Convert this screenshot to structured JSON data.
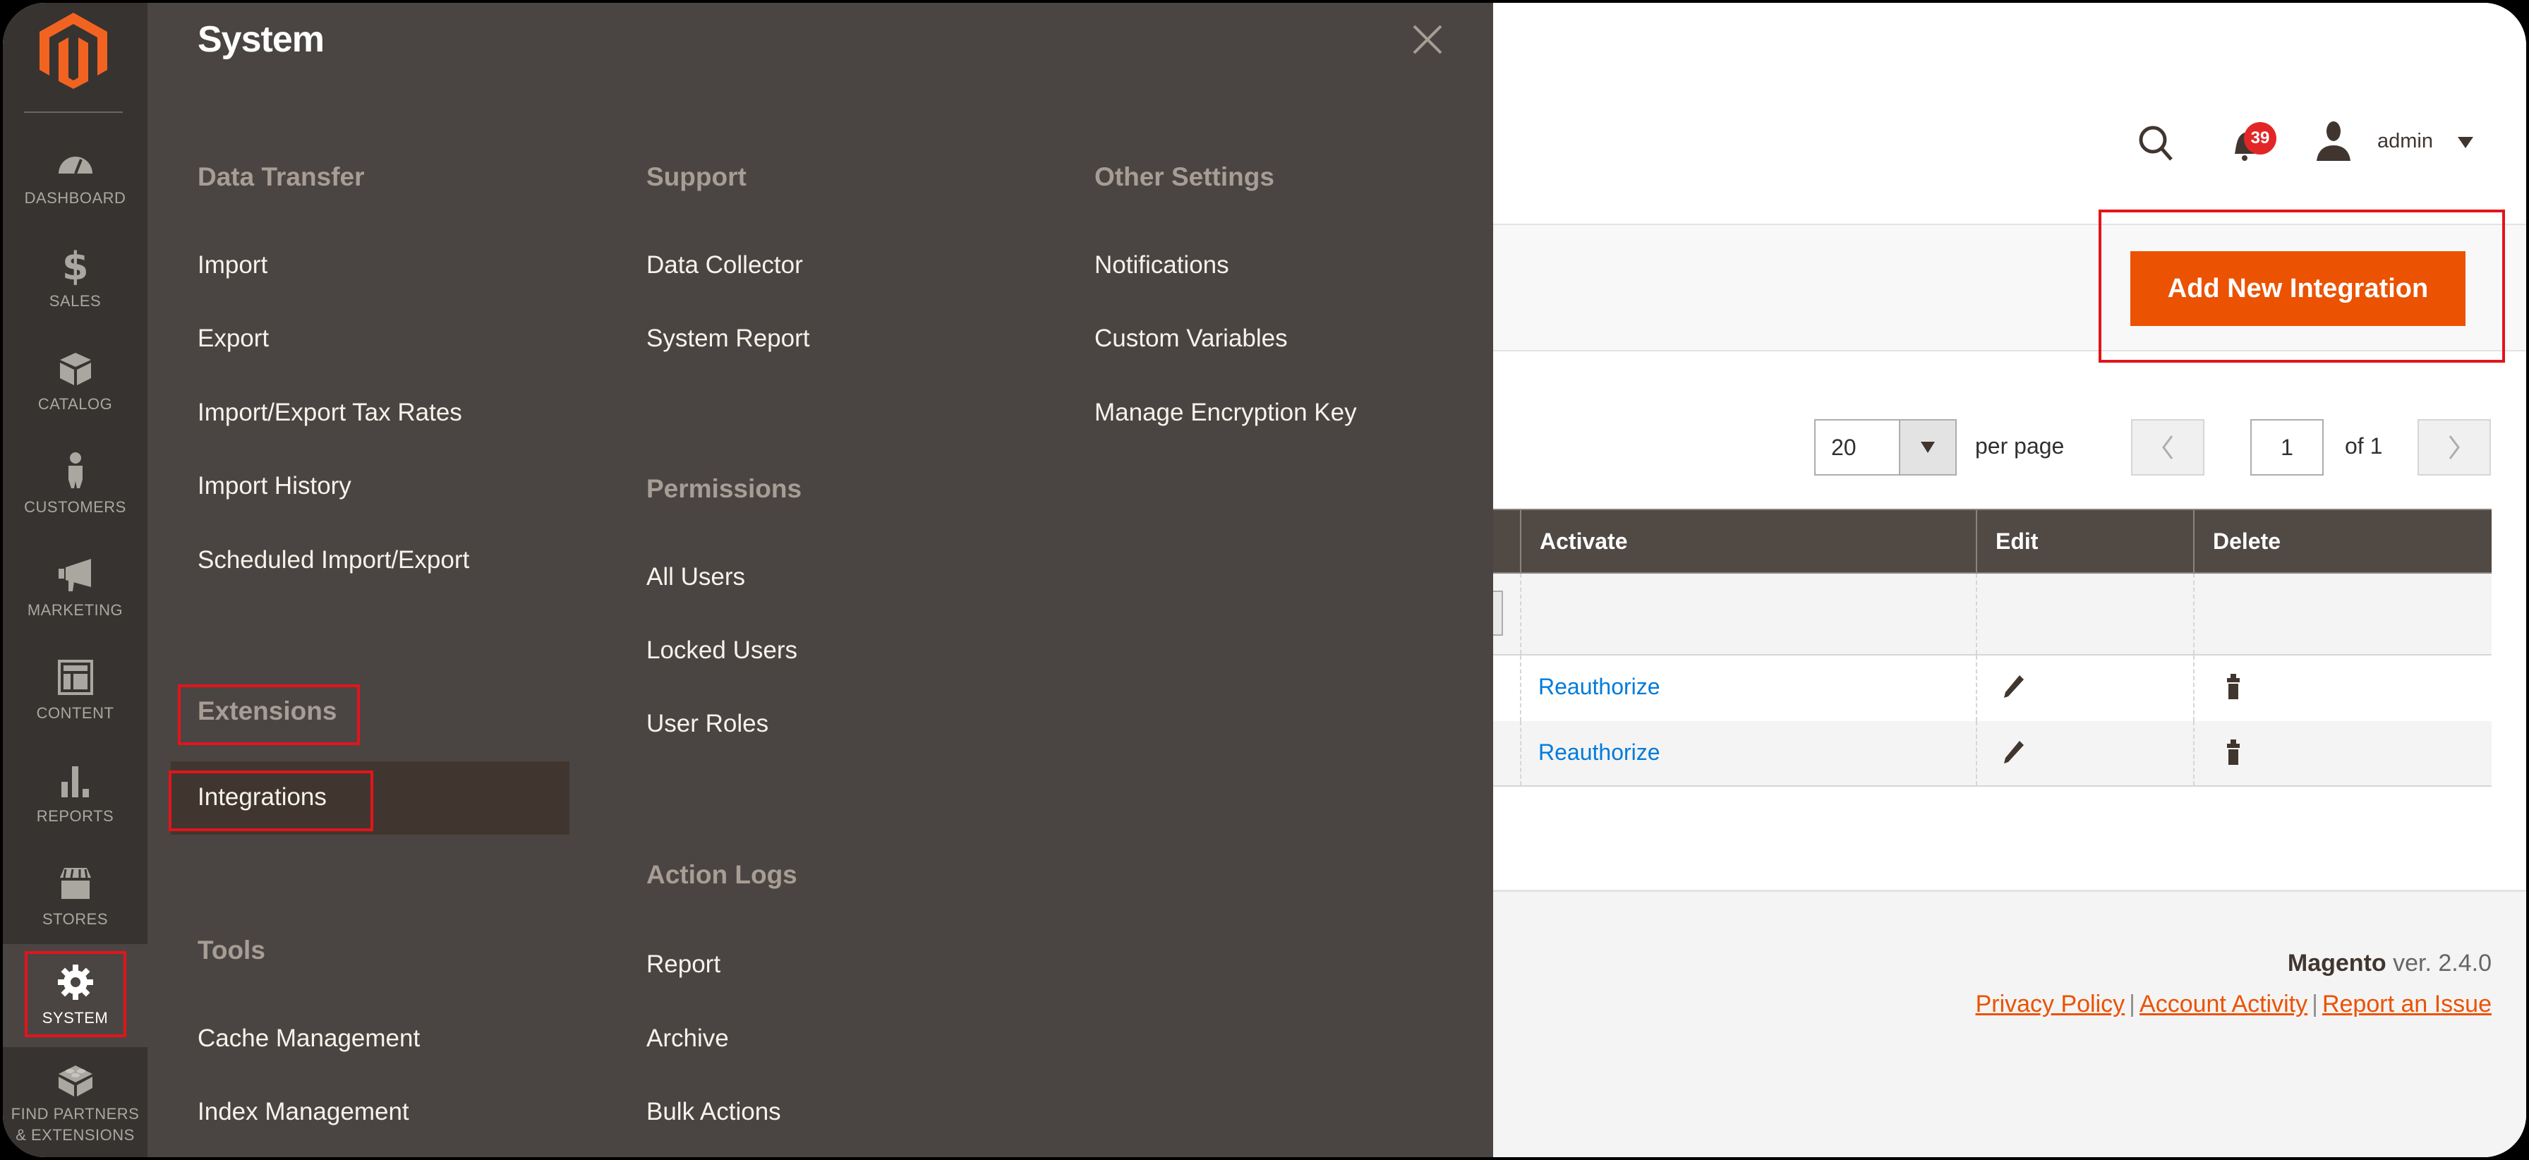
{
  "nav": {
    "logo": "magento-logo",
    "items": [
      {
        "label": "DASHBOARD",
        "icon": "dashboard-gauge-icon"
      },
      {
        "label": "SALES",
        "icon": "dollar-icon"
      },
      {
        "label": "CATALOG",
        "icon": "box-icon"
      },
      {
        "label": "CUSTOMERS",
        "icon": "person-icon"
      },
      {
        "label": "MARKETING",
        "icon": "megaphone-icon"
      },
      {
        "label": "CONTENT",
        "icon": "layout-icon"
      },
      {
        "label": "REPORTS",
        "icon": "bar-chart-icon"
      },
      {
        "label": "STORES",
        "icon": "storefront-icon"
      },
      {
        "label": "SYSTEM",
        "icon": "gear-icon",
        "active": true
      },
      {
        "label": "FIND PARTNERS & EXTENSIONS",
        "icon": "lego-brick-icon"
      }
    ]
  },
  "flyout": {
    "title": "System",
    "close_icon": "close-icon",
    "columns": [
      {
        "groups": [
          {
            "heading": "Data Transfer",
            "items": [
              "Import",
              "Export",
              "Import/Export Tax Rates",
              "Import History",
              "Scheduled Import/Export"
            ]
          },
          {
            "heading": "Extensions",
            "items": [
              "Integrations"
            ]
          },
          {
            "heading": "Tools",
            "items": [
              "Cache Management",
              "Index Management"
            ]
          }
        ]
      },
      {
        "groups": [
          {
            "heading": "Support",
            "items": [
              "Data Collector",
              "System Report"
            ]
          },
          {
            "heading": "Permissions",
            "items": [
              "All Users",
              "Locked Users",
              "User Roles"
            ]
          },
          {
            "heading": "Action Logs",
            "items": [
              "Report",
              "Archive",
              "Bulk Actions"
            ]
          }
        ]
      },
      {
        "groups": [
          {
            "heading": "Other Settings",
            "items": [
              "Notifications",
              "Custom Variables",
              "Manage Encryption Key"
            ]
          }
        ]
      }
    ],
    "current_item": "Integrations"
  },
  "header": {
    "notification_count": "39",
    "username": "admin"
  },
  "page_actions": {
    "add_button": "Add New Integration"
  },
  "pager": {
    "per_page_value": "20",
    "per_page_label": "per page",
    "current_page": "1",
    "of_label": "of 1"
  },
  "grid": {
    "columns": [
      "Activate",
      "Edit",
      "Delete"
    ],
    "rows": [
      {
        "activate": "Reauthorize",
        "edit_icon": "pencil-icon",
        "delete_icon": "trash-icon"
      },
      {
        "activate": "Reauthorize",
        "edit_icon": "pencil-icon",
        "delete_icon": "trash-icon"
      }
    ]
  },
  "footer": {
    "brand": "Magento",
    "version": "ver. 2.4.0",
    "links": [
      "Privacy Policy",
      "Account Activity",
      "Report an Issue"
    ],
    "separator": "|"
  },
  "colors": {
    "accent": "#eb5202",
    "nav_bg": "#373330",
    "flyout_bg": "#4a4542",
    "link_blue": "#007bdb",
    "badge_red": "#e22626",
    "highlight_box": "#e3141b"
  }
}
